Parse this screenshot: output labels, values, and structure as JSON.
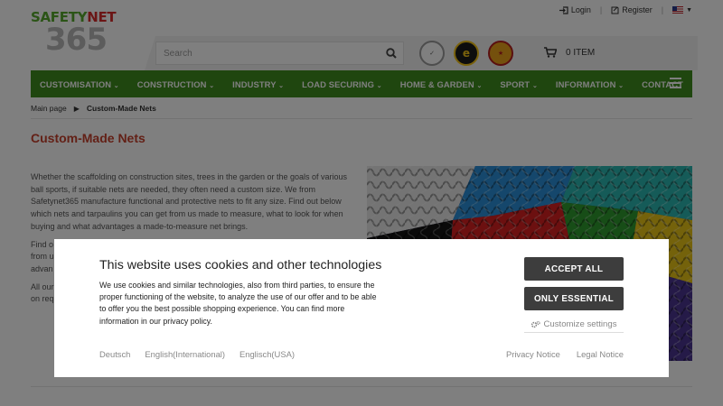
{
  "header": {
    "logo": {
      "line1_a": "SAFETY",
      "line1_b": "NET",
      "line2": "365"
    },
    "login_label": "Login",
    "register_label": "Register",
    "search": {
      "placeholder": "Search",
      "value": ""
    },
    "cart_label": "0 ITEM"
  },
  "nav": {
    "items": [
      {
        "label": "CUSTOMISATION"
      },
      {
        "label": "CONSTRUCTION"
      },
      {
        "label": "INDUSTRY"
      },
      {
        "label": "LOAD SECURING"
      },
      {
        "label": "HOME & GARDEN"
      },
      {
        "label": "SPORT"
      },
      {
        "label": "INFORMATION"
      },
      {
        "label": "CONTACT"
      }
    ]
  },
  "breadcrumb": {
    "home": "Main page",
    "current": "Custom-Made Nets"
  },
  "main": {
    "title": "Custom-Made Nets",
    "paragraph1": "Whether the scaffolding on construction sites, trees in the garden or the goals of various ball sports, if suitable nets are needed, they often need a custom size. We from Safetynet365 manufacture functional and protective nets to fit any size. Find out below which nets and tarpaulins you can get from us made to measure, what to look for when buying and what advantages a made-to-measure net brings.",
    "paragraph2_partial": "Find o\nfrom u\nadvan",
    "paragraph3_partial": "All our\non req"
  },
  "cookie_banner": {
    "title": "This website uses cookies and other technologies",
    "description": "We use cookies and similar technologies, also from third parties, to ensure the proper functioning of the website, to analyze the use of our offer and to be able to offer you the best possible shopping experience. You can find more information in our privacy policy.",
    "accept_all_label": "ACCEPT ALL",
    "only_essential_label": "ONLY ESSENTIAL",
    "customize_label": "Customize settings",
    "languages": [
      "Deutsch",
      "English(International)",
      "Englisch(USA)"
    ],
    "privacy_label": "Privacy Notice",
    "legal_label": "Legal Notice"
  },
  "colors": {
    "nav_green": "#3f8d1e",
    "title_red": "#c7402d",
    "button_dark": "#3d3d3d",
    "logo_green": "#56a92c",
    "logo_red": "#d62b2b"
  }
}
